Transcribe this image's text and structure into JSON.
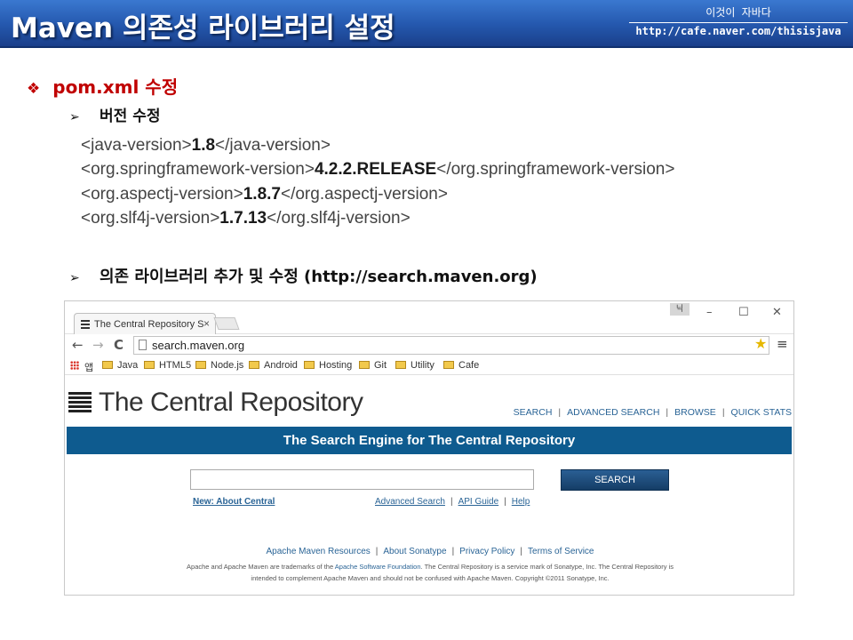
{
  "slide": {
    "title": "Maven 의존성 라이브러리 설정",
    "brand_line1": "이것이 자바다",
    "brand_line2": "http://cafe.naver.com/thisisjava"
  },
  "bullets": {
    "level1_mark": "❖",
    "level1": "pom.xml 수정",
    "sub_mark": "➢",
    "version_edit": "버전 수정",
    "add_library": "의존 라이브러리 추가 및 수정 (http://search.maven.org)"
  },
  "properties": [
    {
      "open": "<java-version>",
      "value": "1.8",
      "close": "</java-version>"
    },
    {
      "open": "<org.springframework-version>",
      "value": "4.2.2.RELEASE",
      "close": "</org.springframework-version>"
    },
    {
      "open": "<org.aspectj-version>",
      "value": "1.8.7",
      "close": "</org.aspectj-version>"
    },
    {
      "open": "<org.slf4j-version>",
      "value": "1.7.13",
      "close": "</org.slf4j-version>"
    }
  ],
  "browser": {
    "tab_title": "The Central Repository S",
    "tab_close": "×",
    "user_badge": "닉",
    "win_minimize": "–",
    "win_maximize": "☐",
    "win_close": "✕",
    "back": "←",
    "forward": "→",
    "reload": "C",
    "url": "search.maven.org",
    "star": "★",
    "menu": "≡",
    "apps_label": "앱",
    "bookmarks": [
      "Java",
      "HTML5",
      "Node.js",
      "Android",
      "Hosting",
      "Git",
      "Utility",
      "Cafe"
    ]
  },
  "site": {
    "logo_text": "The Central Repository",
    "nav": [
      "SEARCH",
      "ADVANCED SEARCH",
      "BROWSE",
      "QUICK STATS"
    ],
    "nav_sep": "|",
    "banner": "The Search Engine for The Central Repository",
    "search_value": "",
    "search_button": "SEARCH",
    "new_link": "New: About Central",
    "sub_links": [
      "Advanced Search",
      "API Guide",
      "Help"
    ],
    "footer_links": [
      "Apache Maven Resources",
      "About Sonatype",
      "Privacy Policy",
      "Terms of Service"
    ],
    "footnote_1a": "Apache and Apache Maven are trademarks of the ",
    "footnote_asf": "Apache Software Foundation",
    "footnote_1b": ". The Central Repository is a service mark of Sonatype, Inc. The Central Repository is",
    "footnote_2": "intended to complement Apache Maven and should not be confused with Apache Maven. Copyright ©2011 Sonatype, Inc."
  }
}
